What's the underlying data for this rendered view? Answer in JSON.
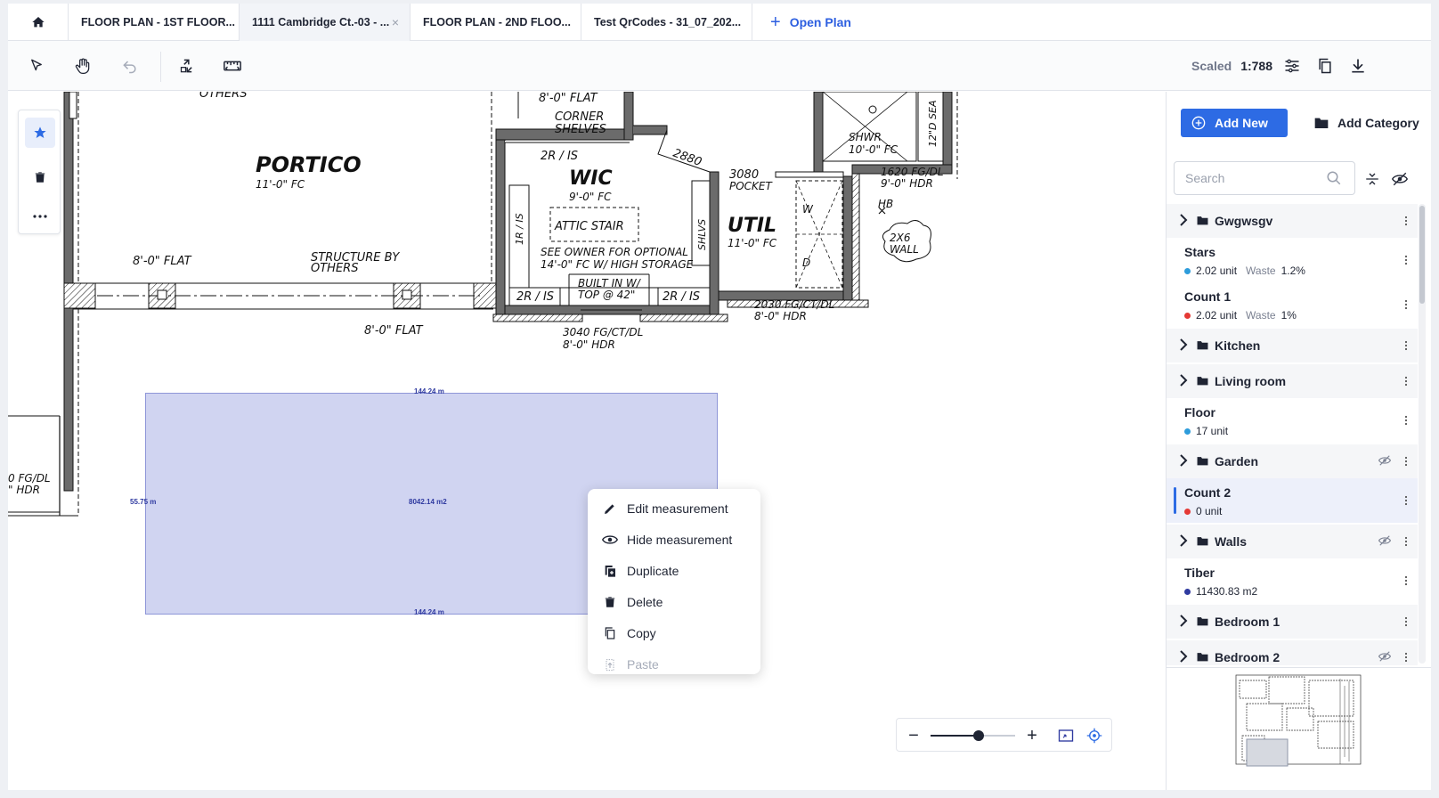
{
  "tabs": [
    {
      "label": "FLOOR PLAN - 1ST FLOOR...",
      "active": false
    },
    {
      "label": "1111 Cambridge Ct.-03 - ...",
      "active": true,
      "closable": true
    },
    {
      "label": "FLOOR PLAN - 2ND FLOO...",
      "active": false
    },
    {
      "label": "Test QrCodes - 31_07_202...",
      "active": false
    }
  ],
  "open_plan_label": "Open Plan",
  "close_glyph": "×",
  "toolbar": {
    "scaled_label": "Scaled",
    "scale_value": "1:788"
  },
  "plan_labels": {
    "others": "OTHERS",
    "portico": "PORTICO",
    "portico_fc": "11'-0\" FC",
    "flat_8_left": "8'-0\" FLAT",
    "structure_by": "STRUCTURE BY",
    "structure_others": "OTHERS",
    "flat_8_bottom": "8'-0\" FLAT",
    "flat_8_top": "8'-0\" FLAT",
    "corner": "CORNER",
    "shelves": "SHELVES",
    "wic": "WIC",
    "wic_fc": "9'-0\" FC",
    "attic_stair": "ATTIC STAIR",
    "see_owner": "SEE OWNER FOR OPTIONAL",
    "high_storage": "14'-0\" FC W/ HIGH STORAGE",
    "built_in": "BUILT IN W/",
    "top_at": "TOP @ 42\"",
    "two_r_is_a": "2R / IS",
    "two_r_is_b": "2R / IS",
    "two_r_is_c": "2R / IS",
    "one_r_is": "1R / IS",
    "shlvs": "SHLVS",
    "door_2880": "2880",
    "pocket_num": "3080",
    "pocket": "POCKET",
    "util": "UTIL",
    "util_fc": "11'-0\" FC",
    "shwr": "SHWR",
    "shwr_fc": "10'-0\" FC",
    "seat": "12\"D SEA",
    "fg_1620": "1620 FG/DL",
    "hdr_9": "9'-0\" HDR",
    "hb": "HB",
    "wall_2x6": "2X6",
    "wall": "WALL",
    "w": "W",
    "d": "D",
    "fg_2030": "2030 FG/CT/DL",
    "hdr_8a": "8'-0\" HDR",
    "fg_3040": "3040 FG/CT/DL",
    "hdr_8b": "8'-0\" HDR",
    "fg_left": "0 FG/DL",
    "hdr_left": "\" HDR"
  },
  "measurement": {
    "top_length": "144.24 m",
    "bottom_length": "144.24 m",
    "side_length": "55.75 m",
    "area": "8042.14 m2"
  },
  "context_menu": [
    {
      "label": "Edit measurement",
      "icon": "pencil-icon",
      "disabled": false
    },
    {
      "label": "Hide measurement",
      "icon": "eye-icon",
      "disabled": false
    },
    {
      "label": "Duplicate",
      "icon": "duplicate-icon",
      "disabled": false
    },
    {
      "label": "Delete",
      "icon": "trash-icon",
      "disabled": false
    },
    {
      "label": "Copy",
      "icon": "copy-icon",
      "disabled": false
    },
    {
      "label": "Paste",
      "icon": "paste-icon",
      "disabled": true
    }
  ],
  "zoom": {
    "level": 0.57,
    "minus": "−",
    "plus": "+"
  },
  "panel": {
    "add_new_label": "Add New",
    "add_category_label": "Add Category",
    "search_placeholder": "Search",
    "waste_label": "Waste",
    "items": [
      {
        "type": "group",
        "name": "Gwgwsgv",
        "hidden": false
      },
      {
        "type": "item",
        "name": "Stars",
        "value": "2.02 unit",
        "waste": "1.2%",
        "color": "#2d9cdb"
      },
      {
        "type": "item",
        "name": "Count 1",
        "value": "2.02 unit",
        "waste": "1%",
        "color": "#e53935"
      },
      {
        "type": "group",
        "name": "Kitchen",
        "hidden": false
      },
      {
        "type": "group",
        "name": "Living room",
        "hidden": false
      },
      {
        "type": "item",
        "name": "Floor",
        "value": "17 unit",
        "color": "#2d9cdb"
      },
      {
        "type": "group",
        "name": "Garden",
        "hidden": true
      },
      {
        "type": "item",
        "name": "Count 2",
        "value": "0 unit",
        "color": "#e53935",
        "selected": true
      },
      {
        "type": "group",
        "name": "Walls",
        "hidden": true
      },
      {
        "type": "item",
        "name": "Tiber",
        "value": "11430.83 m2",
        "color": "#2f3aa0"
      },
      {
        "type": "group",
        "name": "Bedroom 1",
        "hidden": false
      },
      {
        "type": "group",
        "name": "Bedroom 2",
        "hidden": true
      }
    ]
  },
  "colors": {
    "accent": "#2d6be4",
    "measurement_fill": "#aab0e6",
    "selected_bar": "#2d6be4"
  }
}
